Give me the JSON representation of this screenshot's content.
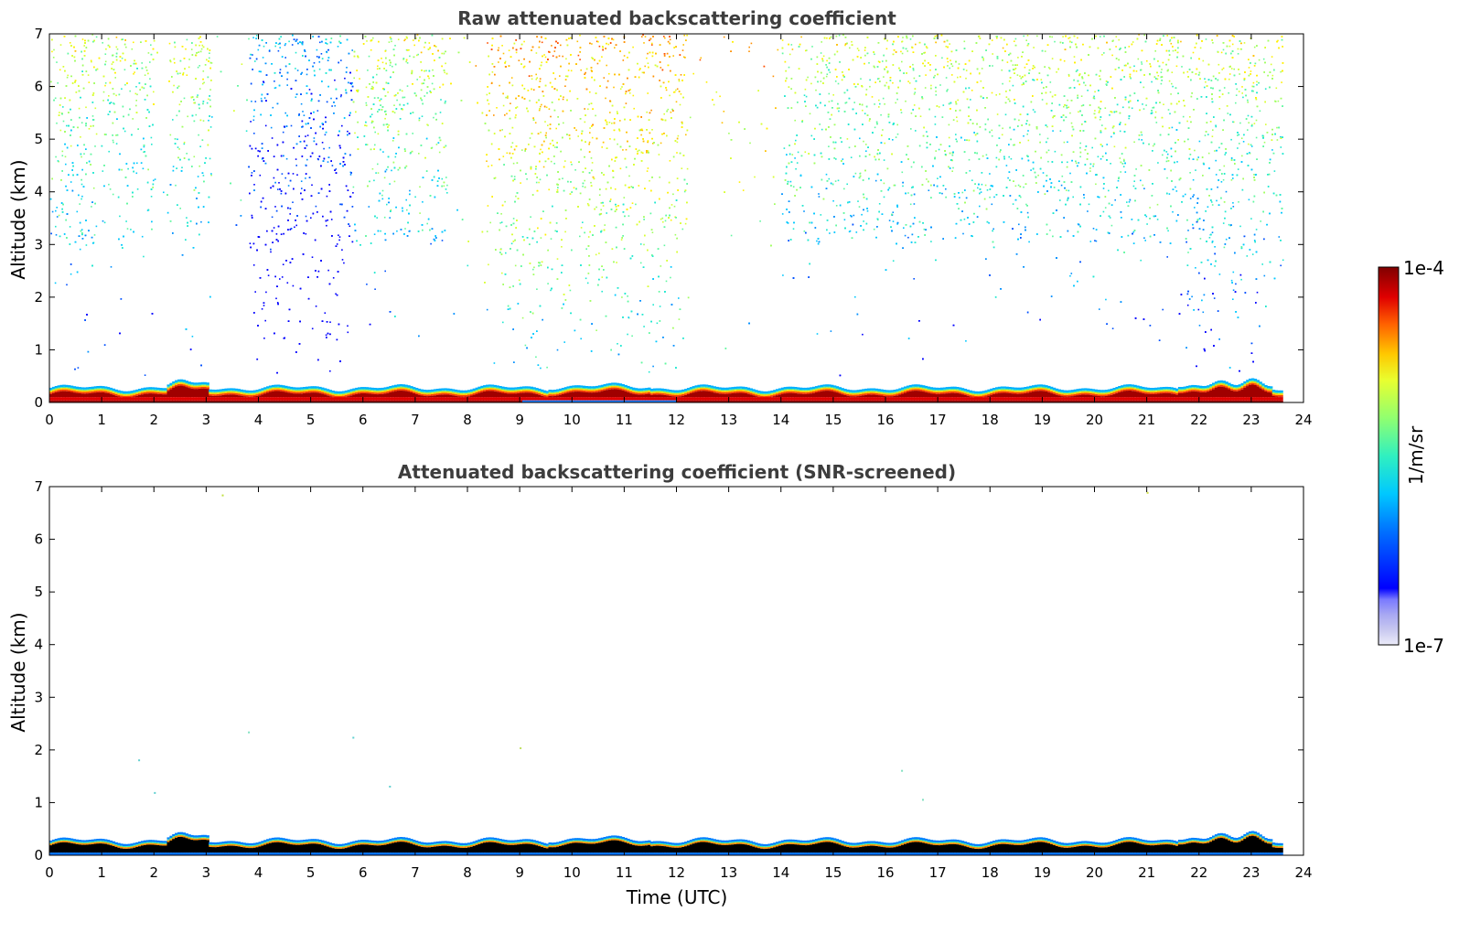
{
  "chart_data": [
    {
      "type": "heatmap",
      "title": "Raw attenuated backscattering coefficient",
      "xlabel": "",
      "ylabel": "Altitude (km)",
      "xlim": [
        0,
        24
      ],
      "ylim": [
        0,
        7
      ],
      "x_ticks": [
        "0",
        "1",
        "2",
        "3",
        "4",
        "5",
        "6",
        "7",
        "8",
        "9",
        "10",
        "11",
        "12",
        "13",
        "14",
        "15",
        "16",
        "17",
        "18",
        "19",
        "20",
        "21",
        "22",
        "23",
        "24"
      ],
      "y_ticks": [
        "0",
        "1",
        "2",
        "3",
        "4",
        "5",
        "6",
        "7"
      ],
      "data_end_time": 23.6,
      "grid": false,
      "features": {
        "boundary_layer": {
          "altitude_km": [
            0,
            0.35
          ],
          "level": "high (red / dark red)"
        },
        "upper_noise": {
          "altitude_km": [
            3,
            7
          ],
          "level": "low-mid (blue to yellow speckle)"
        },
        "clear_gaps_hours": [
          [
            0.9,
            1.0
          ],
          [
            2.0,
            2.3
          ],
          [
            3.1,
            3.8
          ],
          [
            5.9,
            6.0
          ],
          [
            7.6,
            8.3
          ],
          [
            12.2,
            14.0
          ]
        ]
      }
    },
    {
      "type": "heatmap",
      "title": "Attenuated backscattering coefficient (SNR-screened)",
      "xlabel": "Time (UTC)",
      "ylabel": "Altitude (km)",
      "xlim": [
        0,
        24
      ],
      "ylim": [
        0,
        7
      ],
      "x_ticks": [
        "0",
        "1",
        "2",
        "3",
        "4",
        "5",
        "6",
        "7",
        "8",
        "9",
        "10",
        "11",
        "12",
        "13",
        "14",
        "15",
        "16",
        "17",
        "18",
        "19",
        "20",
        "21",
        "22",
        "23",
        "24"
      ],
      "y_ticks": [
        "0",
        "1",
        "2",
        "3",
        "4",
        "5",
        "6",
        "7"
      ],
      "data_end_time": 23.6,
      "grid": false,
      "features": {
        "boundary_layer": {
          "altitude_km": [
            0,
            0.35
          ],
          "level": "high (dark / saturated)"
        },
        "upper_noise": "removed"
      }
    }
  ],
  "colorbar": {
    "max_label": "1e-4",
    "min_label": "1e-7",
    "unit_label": "1/m/sr",
    "colormap": "jet",
    "colors": [
      "#e8e8f8",
      "#c8c8f0",
      "#a0a0f0",
      "#0000ff",
      "#0060ff",
      "#00c0ff",
      "#20e0c0",
      "#80ff80",
      "#e0ff40",
      "#ffd000",
      "#ff7000",
      "#ff2000",
      "#c00000",
      "#800000"
    ]
  }
}
